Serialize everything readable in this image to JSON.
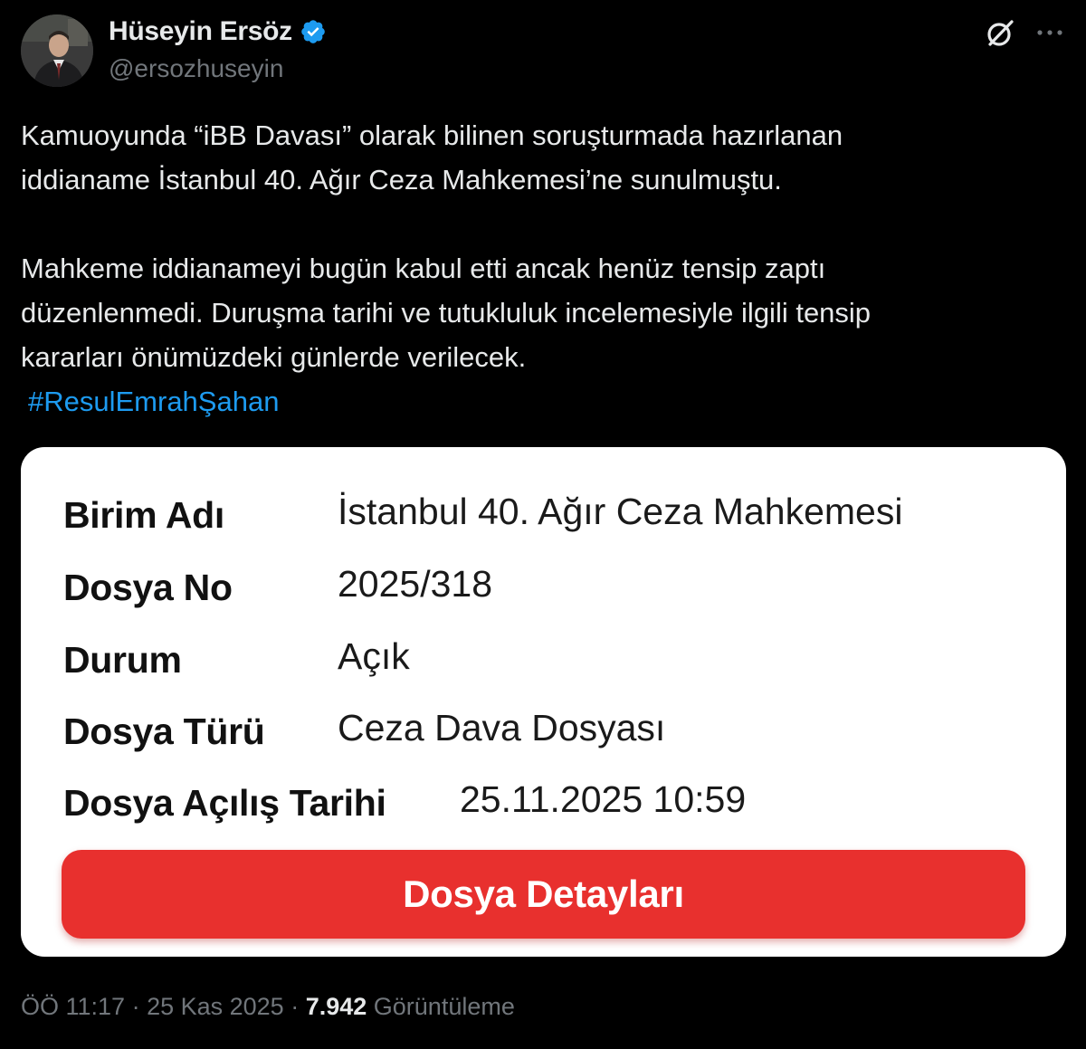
{
  "author": {
    "display_name": "Hüseyin Ersöz",
    "handle": "@ersozhuseyin",
    "verified_color": "#1d9bf0",
    "avatar_icon": "profile-photo"
  },
  "header_actions": {
    "grok_icon": "grok-icon",
    "more_icon": "more-icon"
  },
  "tweet": {
    "paragraphs": [
      "Kamuoyunda “iBB Davası” olarak bilinen soruşturmada hazırlanan",
      "iddianame İstanbul 40. Ağır Ceza Mahkemesi’ne sunulmuştu.",
      "Mahkeme iddianameyi bugün kabul etti ancak henüz tensip zaptı",
      "düzenlenmedi. Duruşma tarihi ve tutukluluk incelemesiyle ilgili tensip",
      "kararları önümüzdeki günlerde verilecek."
    ],
    "hashtag": "#ResulEmrahŞahan"
  },
  "case_card": {
    "rows": [
      {
        "label": "Birim Adı",
        "value": "İstanbul 40. Ağır Ceza Mahkemesi"
      },
      {
        "label": "Dosya No",
        "value": "2025/318"
      },
      {
        "label": "Durum",
        "value": "Açık"
      },
      {
        "label": "Dosya Türü",
        "value": "Ceza Dava Dosyası"
      },
      {
        "label": "Dosya Açılış Tarihi",
        "value": "25.11.2025 10:59"
      }
    ],
    "button_label": "Dosya Detayları",
    "button_color": "#e8302e"
  },
  "meta": {
    "time": "ÖÖ 11:17",
    "separator": " · ",
    "date": "25 Kas 2025",
    "views_count": "7.942",
    "views_label": " Görüntüleme"
  }
}
